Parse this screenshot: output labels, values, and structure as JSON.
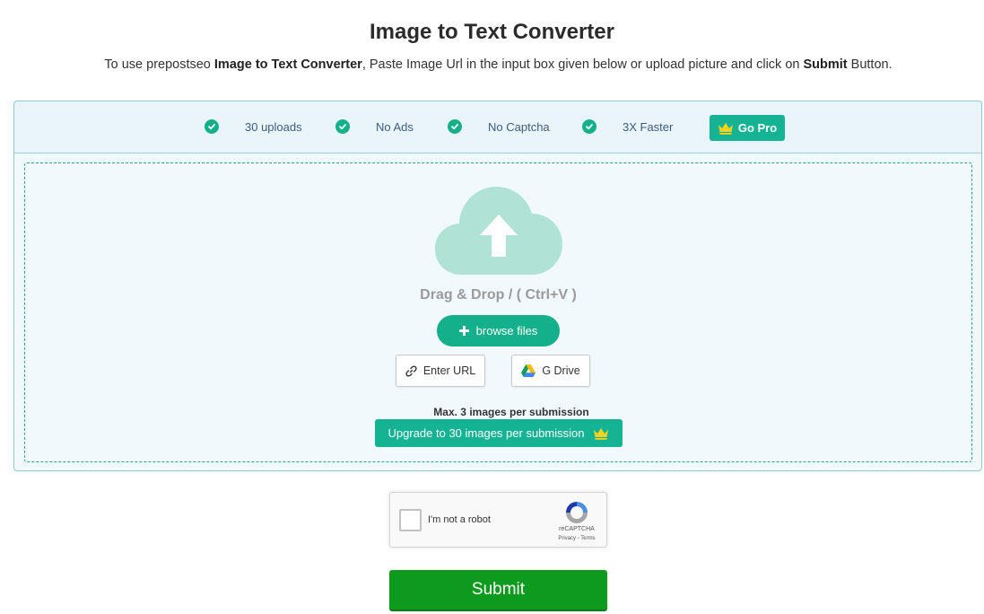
{
  "header": {
    "title": "Image to Text Converter",
    "desc_prefix": "To use prepostseo ",
    "desc_bold1": "Image to Text Converter",
    "desc_middle": ", Paste Image Url in the input box given below or upload picture and click on ",
    "desc_bold2": "Submit",
    "desc_suffix": " Button."
  },
  "features": [
    {
      "label": "30 uploads",
      "icon": "check-circle-icon"
    },
    {
      "label": "No Ads",
      "icon": "check-circle-icon"
    },
    {
      "label": "No Captcha",
      "icon": "check-circle-icon"
    },
    {
      "label": "3X Faster",
      "icon": "check-circle-icon"
    }
  ],
  "go_pro": {
    "label": "Go Pro",
    "icon": "crown-icon"
  },
  "upload": {
    "cloud_icon": "cloud-upload-icon",
    "drag_text": "Drag & Drop / ( Ctrl+V )",
    "browse_label": "browse files",
    "enter_url_label": "Enter URL",
    "gdrive_label": "G Drive",
    "max_text": "Max. 3 images per submission",
    "upgrade_label": "Upgrade to 30 images per submission"
  },
  "recaptcha": {
    "label": "I'm not a robot",
    "brand": "reCAPTCHA",
    "terms": "Privacy - Terms"
  },
  "submit_label": "Submit",
  "colors": {
    "accent": "#14b08c",
    "submit": "#0e9a1e",
    "crown": "#f7d21c"
  }
}
